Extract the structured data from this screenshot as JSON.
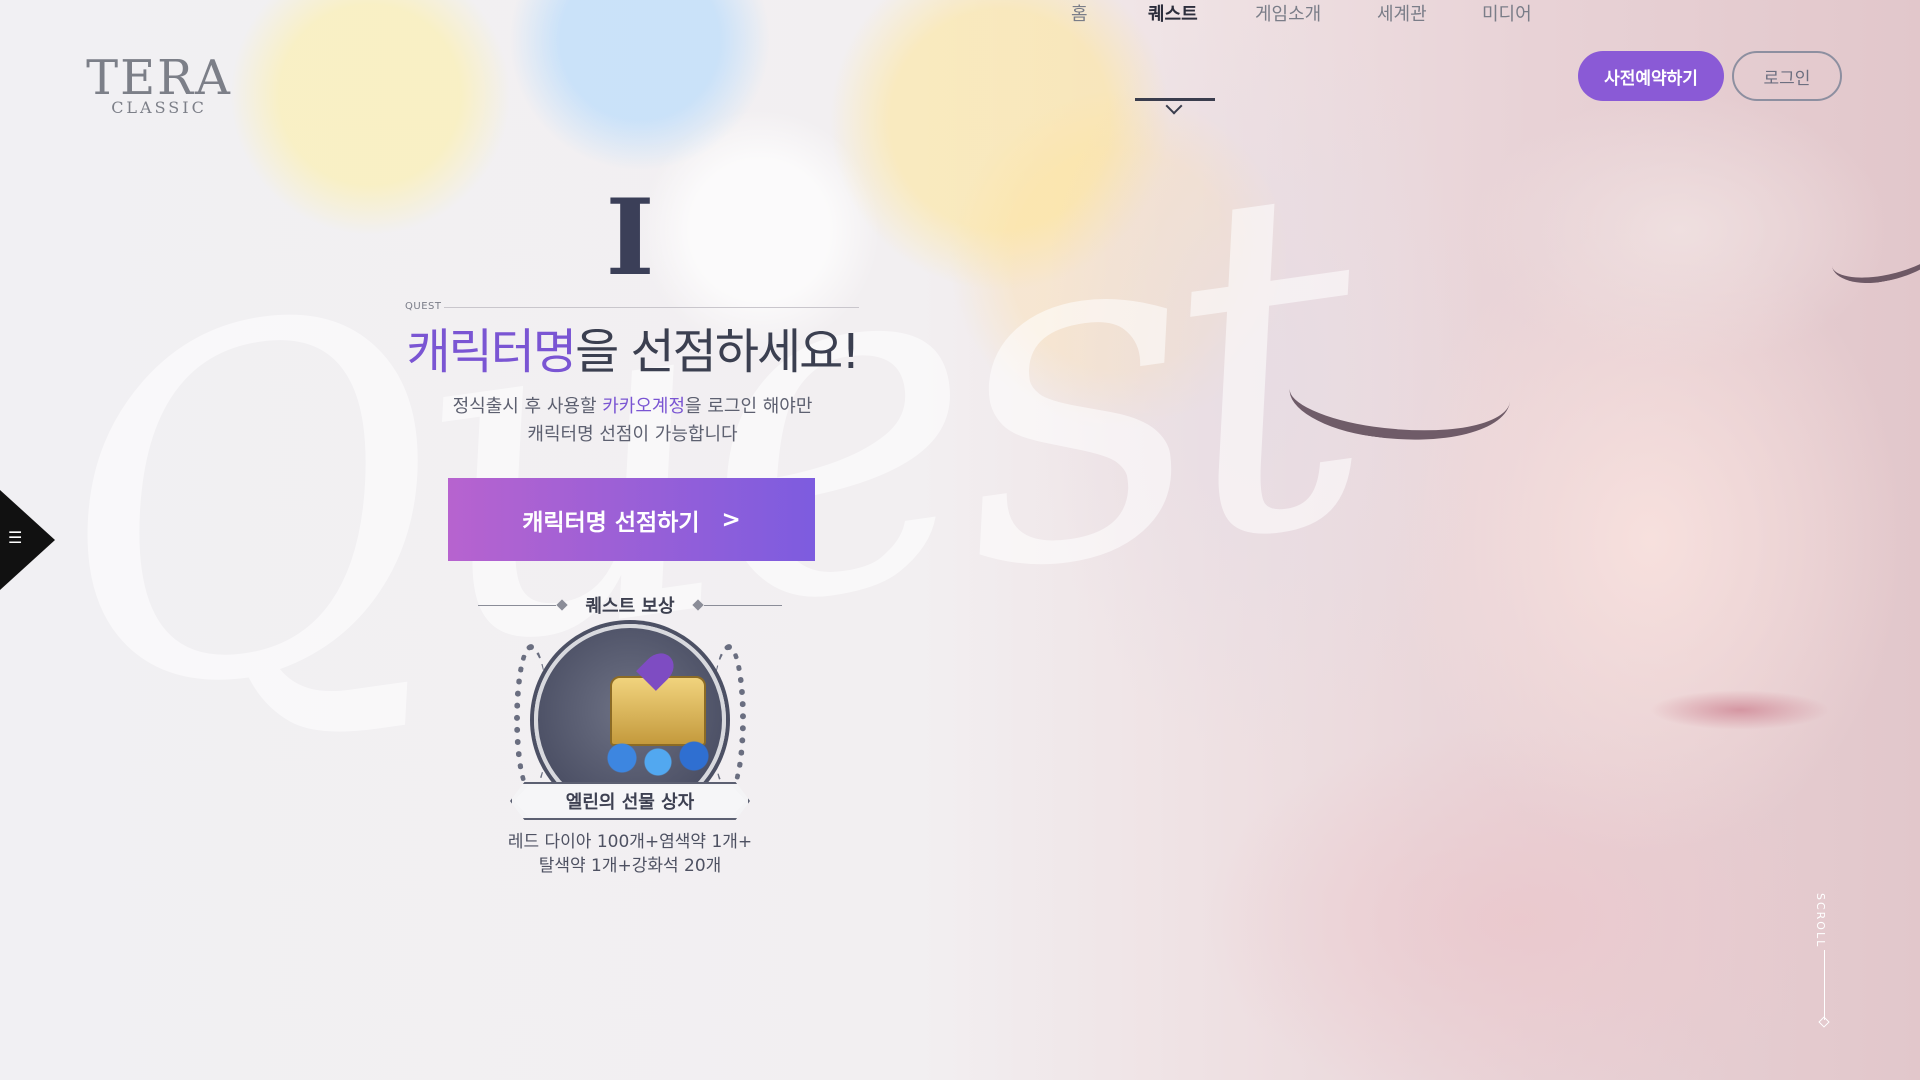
{
  "header": {
    "logo": {
      "line1": "TERA",
      "line2": "CLASSIC"
    },
    "nav": [
      {
        "label": "홈",
        "active": false
      },
      {
        "label": "퀘스트",
        "active": true
      },
      {
        "label": "게임소개",
        "active": false
      },
      {
        "label": "세계관",
        "active": false
      },
      {
        "label": "미디어",
        "active": false
      }
    ],
    "preregister_label": "사전예약하기",
    "login_label": "로그인"
  },
  "side_menu": {
    "icon": "hamburger-menu-icon"
  },
  "quest": {
    "number": "I",
    "label": "QUEST",
    "headline_accent": "캐릭터명",
    "headline_rest": "을 선점하세요!",
    "desc_line1_before": "정식출시 후 사용할 ",
    "desc_line1_accent": "카카오계정",
    "desc_line1_after": "을 로그인 해야만",
    "desc_line2": "캐릭터명 선점이 가능합니다",
    "cta_label": "캐릭터명 선점하기",
    "cta_arrow": ">",
    "watermark": "Quest"
  },
  "reward": {
    "title": "퀘스트 보상",
    "item_name": "엘린의 선물 상자",
    "detail_line1": "레드 다이아 100개+염색약 1개+",
    "detail_line2": "탈색약 1개+강화석 20개"
  },
  "scroll": {
    "label": "SCROLL"
  },
  "colors": {
    "accent": "#7a55d3",
    "cta_gradient_start": "#b763cf",
    "cta_gradient_end": "#7d5cdf",
    "prereg_button": "#8a5ad6"
  }
}
